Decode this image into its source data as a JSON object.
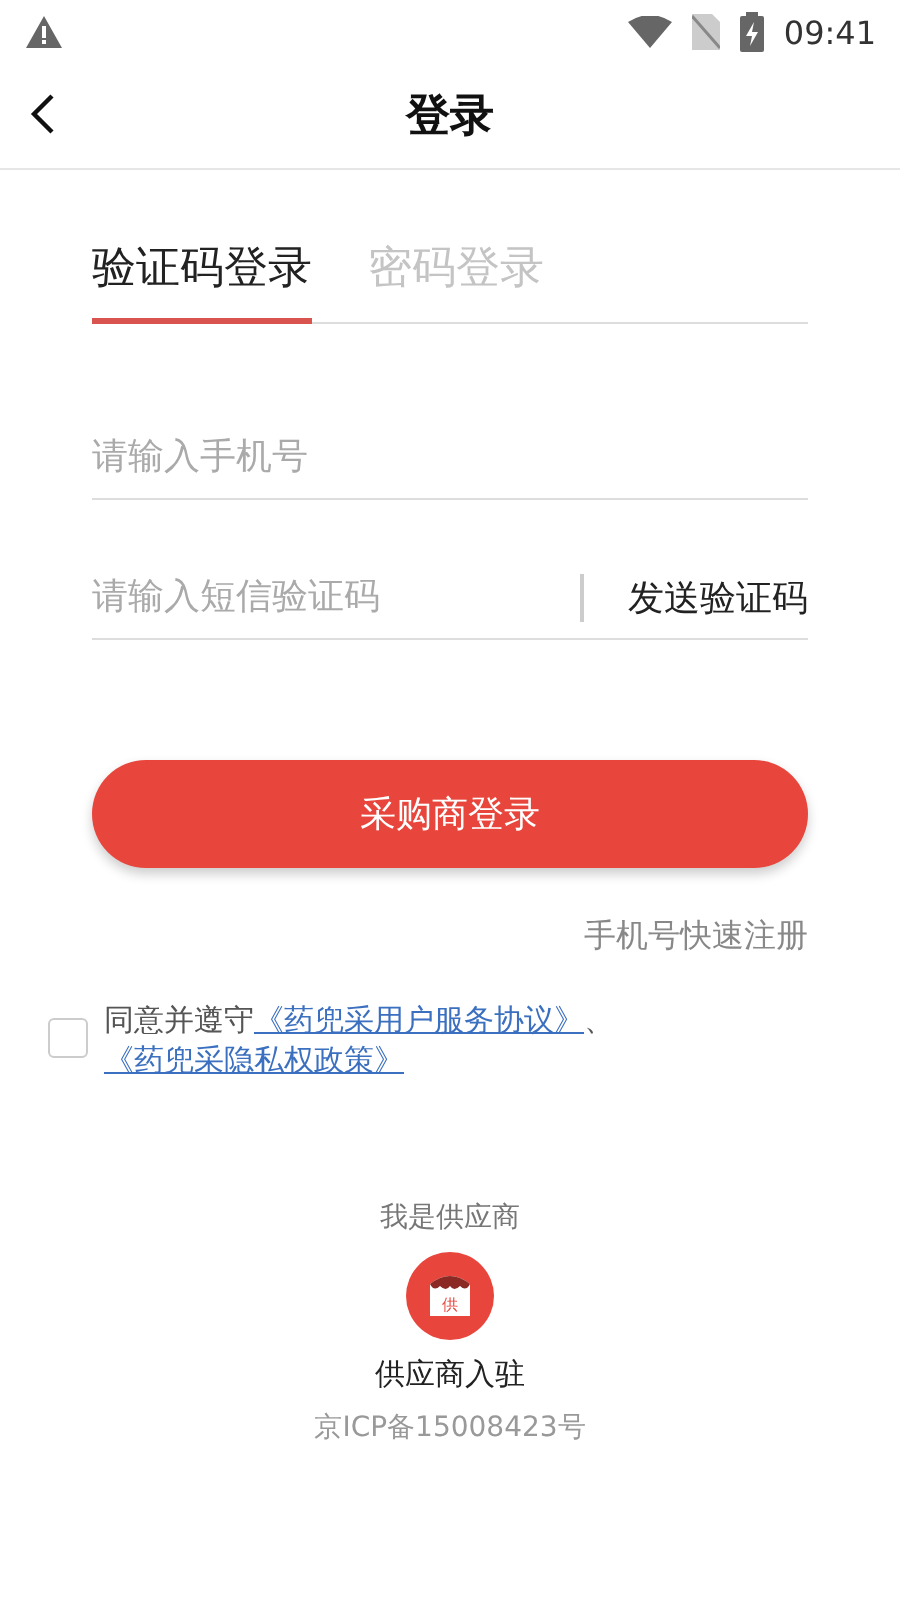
{
  "status_bar": {
    "time": "09:41"
  },
  "header": {
    "title": "登录"
  },
  "tabs": [
    {
      "label": "验证码登录",
      "selected": true
    },
    {
      "label": "密码登录",
      "selected": false
    }
  ],
  "phone_field": {
    "placeholder": "请输入手机号"
  },
  "code_field": {
    "placeholder": "请输入短信验证码",
    "send_button": "发送验证码"
  },
  "login_button": "采购商登录",
  "register_link": "手机号快速注册",
  "agreement": {
    "checked": false,
    "prefix": "同意并遵守",
    "link_1": "《药兜采用户服务协议》",
    "separator": "、",
    "link_2": "《药兜采隐私权政策》"
  },
  "supplier": {
    "caption": "我是供应商",
    "icon_label": "供",
    "button": "供应商入驻"
  },
  "footer": "京ICP备15008423号"
}
